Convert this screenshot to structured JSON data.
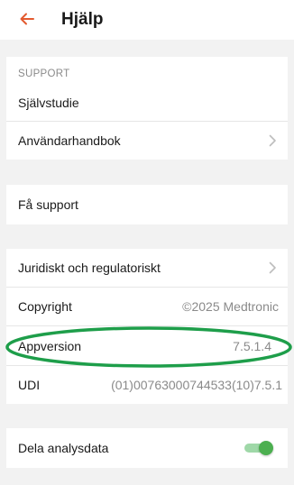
{
  "header": {
    "title": "Hjälp",
    "back_icon": "arrow-left-icon"
  },
  "colors": {
    "accent": "#e35a2f",
    "toggle_on": "#4caf50",
    "highlight": "#1e9e4a"
  },
  "support_section": {
    "header": "SUPPORT",
    "items": [
      {
        "label": "Självstudie"
      },
      {
        "label": "Användarhandbok",
        "icon": "chevron-right-icon"
      }
    ]
  },
  "get_support": {
    "label": "Få support"
  },
  "info_section": {
    "legal": {
      "label": "Juridiskt och regulatoriskt",
      "icon": "chevron-right-icon"
    },
    "copyright": {
      "label": "Copyright",
      "value": "©2025 Medtronic"
    },
    "app_version": {
      "label": "Appversion",
      "value": "7.5.1.4"
    },
    "udi": {
      "label": "UDI",
      "value": "(01)00763000744533(10)7.5.1"
    }
  },
  "analytics": {
    "label": "Dela analysdata",
    "enabled": true
  }
}
